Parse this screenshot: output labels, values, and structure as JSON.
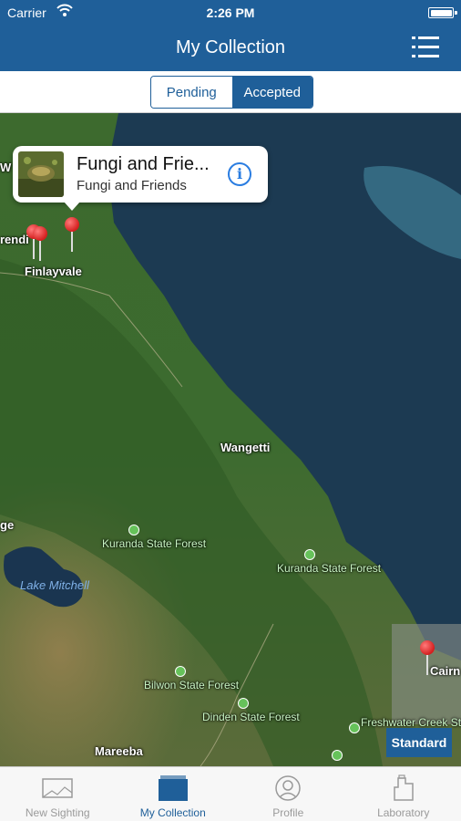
{
  "status_bar": {
    "carrier": "Carrier",
    "time": "2:26 PM"
  },
  "nav": {
    "title": "My Collection",
    "menu_icon": "list-menu-icon"
  },
  "segments": {
    "pending": "Pending",
    "accepted": "Accepted",
    "selected": "Accepted"
  },
  "map": {
    "places": {
      "finlayvale": "Finlayvale",
      "wangetti": "Wangetti",
      "lake_mitchell": "Lake Mitchell",
      "kuranda": "Kuranda State Forest",
      "kuranda2": "Kuranda State Forest",
      "bilwon": "Bilwon State Forest",
      "dinden": "Dinden State Forest",
      "freshwater": "Freshwater Creek State",
      "mareeba": "Mareeba",
      "cairns": "Cairn",
      "edge_left": "ge",
      "edge_w": "W",
      "edge_rendi": "rendi"
    },
    "callout": {
      "title": "Fungi and Frie...",
      "subtitle": "Fungi and Friends",
      "info_icon": "info-icon"
    },
    "map_type_button": "Standard"
  },
  "tabs": [
    {
      "label": "New Sighting",
      "icon": "new-sighting-icon"
    },
    {
      "label": "My Collection",
      "icon": "collection-icon"
    },
    {
      "label": "Profile",
      "icon": "profile-icon"
    },
    {
      "label": "Laboratory",
      "icon": "laboratory-icon"
    }
  ],
  "active_tab": "My Collection",
  "colors": {
    "brand": "#1f5f99",
    "pin": "#d41f1f",
    "ocean": "#1c3a52"
  }
}
